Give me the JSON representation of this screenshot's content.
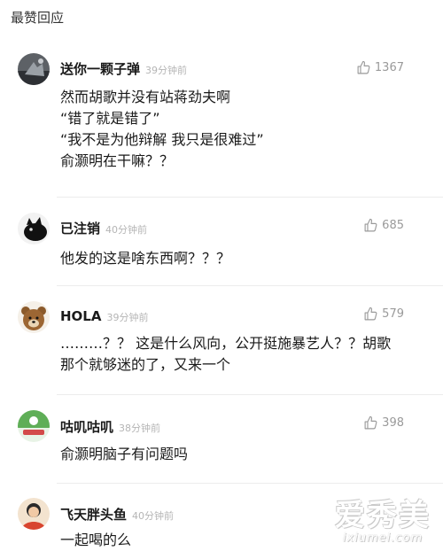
{
  "section_title": "最赞回应",
  "comments": [
    {
      "user": "送你一颗子弹",
      "time": "39分钟前",
      "likes": "1367",
      "lines": [
        "然而胡歌并没有站蒋劲夫啊",
        "“错了就是错了”",
        "“我不是为他辩解 我只是很难过”",
        "俞灏明在干嘛？？"
      ]
    },
    {
      "user": "已注销",
      "time": "40分钟前",
      "likes": "685",
      "lines": [
        "他发的这是啥东西啊？？？"
      ]
    },
    {
      "user": "HOLA",
      "time": "39分钟前",
      "likes": "579",
      "lines": [
        "………？？ 这是什么风向，公开挺施暴艺人？？胡歌",
        "那个就够迷的了，又来一个"
      ]
    },
    {
      "user": "咕叽咕叽",
      "time": "38分钟前",
      "likes": "398",
      "lines": [
        "俞灏明脑子有问题吗"
      ]
    },
    {
      "user": "飞天胖头鱼",
      "time": "40分钟前",
      "likes": "",
      "lines": [
        "一起喝的么"
      ]
    }
  ],
  "watermark": {
    "main": "爱秀美",
    "sub": "ixiumei.com"
  },
  "icons": {
    "like": "thumbs-up-icon"
  },
  "colors": {
    "muted": "#9a9a9a",
    "divider": "#ececec"
  }
}
